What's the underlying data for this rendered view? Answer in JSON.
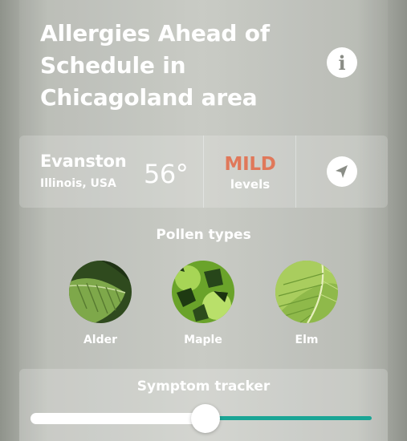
{
  "headline": "Allergies Ahead of Schedule in Chicagoland area",
  "info_icon": "info-icon",
  "location": {
    "city": "Evanston",
    "region": "Illinois, USA",
    "temperature": "56°",
    "level": "MILD",
    "level_suffix": "levels",
    "level_color": "#e0785a",
    "nav_icon": "location-arrow-icon"
  },
  "pollen": {
    "heading": "Pollen types",
    "types": [
      {
        "label": "Alder"
      },
      {
        "label": "Maple"
      },
      {
        "label": "Elm"
      }
    ]
  },
  "tracker": {
    "title": "Symptom tracker",
    "accent": "#1aa595",
    "value_fraction": 0.52
  }
}
